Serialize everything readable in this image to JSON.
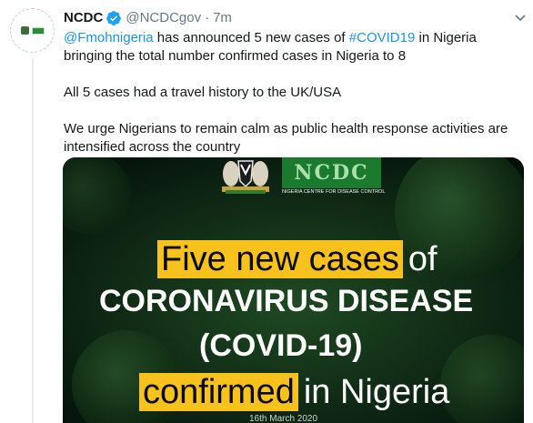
{
  "tweet": {
    "display_name": "NCDC",
    "handle": "@NCDCgov",
    "separator": "·",
    "time": "7m",
    "mention": "@Fmohnigeria",
    "text_part1": " has announced 5 new cases of ",
    "hashtag": "#COVID19",
    "text_part2": " in Nigeria bringing the total number confirmed cases in Nigeria to 8",
    "paragraph2": "All 5 cases had a travel history to the UK/USA",
    "paragraph3": "We urge Nigerians to remain calm as public health response activities are intensified across the country"
  },
  "media": {
    "logo_text": "NCDC",
    "logo_subtitle": "NIGERIA CENTRE FOR DISEASE CONTROL",
    "line1_highlight": "Five new cases",
    "line1_rest": "of",
    "line2": "CORONAVIRUS DISEASE",
    "line3": "(COVID-19)",
    "line4_highlight": "confirmed",
    "line4_rest": "in Nigeria",
    "line5": "16th March 2020"
  },
  "icons": {
    "verified": "verified-badge-icon",
    "chevron": "chevron-down-icon"
  },
  "colors": {
    "link": "#1b95e0",
    "verified": "#1da1f2",
    "highlight": "#f7c21b",
    "media_bg": "#071a0a"
  }
}
